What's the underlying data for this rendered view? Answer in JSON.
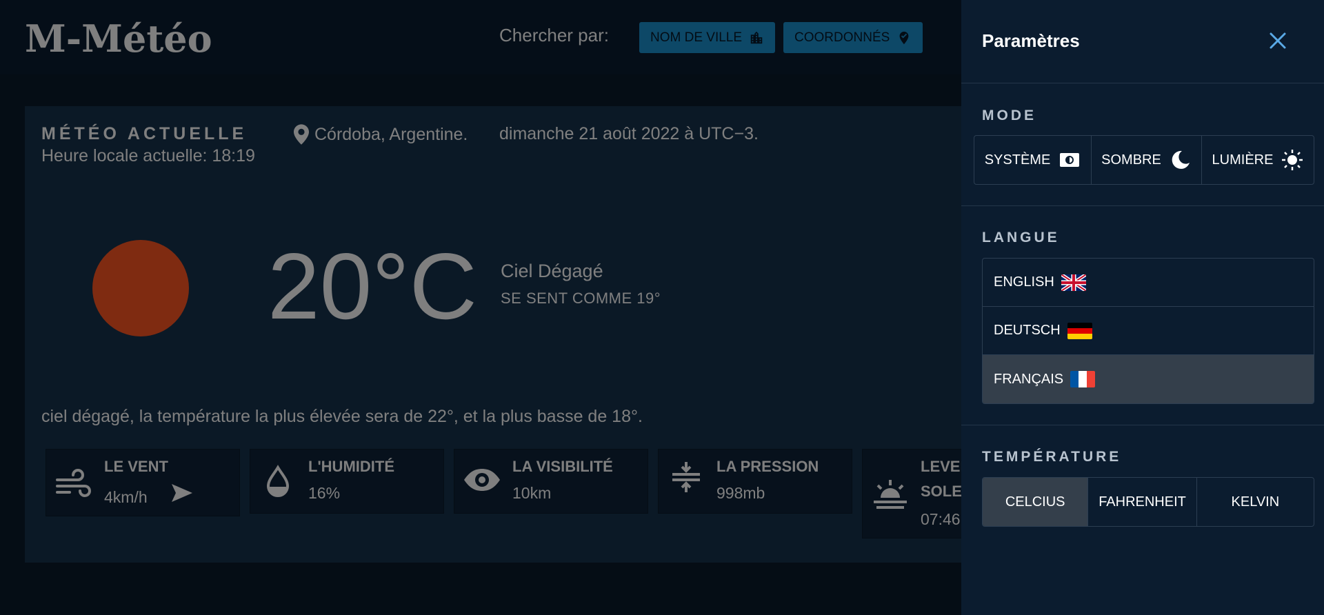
{
  "header": {
    "logo": "M-Météo",
    "search_label": "Chercher par:",
    "city_button": "NOM DE VILLE",
    "coords_button": "COORDONNÉS"
  },
  "current": {
    "title": "MÉTÉO ACTUELLE",
    "local_time": "Heure locale actuelle: 18:19",
    "location": "Córdoba, Argentine.",
    "date": "dimanche 21 août 2022 à UTC−3.",
    "temperature": "20°C",
    "condition": "Ciel Dégagé",
    "feels_like": "SE SENT COMME 19°",
    "summary": "ciel dégagé, la température la plus élevée sera de 22°, et la plus basse de 18°."
  },
  "tiles": [
    {
      "label": "LE VENT",
      "value": "4km/h",
      "icon": "wind-icon"
    },
    {
      "label": "L'HUMIDITÉ",
      "value": "16%",
      "icon": "water-drop-icon"
    },
    {
      "label": "LA VISIBILITÉ",
      "value": "10km",
      "icon": "eye-icon"
    },
    {
      "label": "LA PRESSION",
      "value": "998mb",
      "icon": "compress-icon"
    },
    {
      "label": "LEVER DU SOLEIL",
      "label_line1": "LEVER",
      "label_line2": "SOLEIL",
      "value": "07:46",
      "icon": "sunrise-icon"
    }
  ],
  "settings": {
    "title": "Paramètres",
    "mode_label": "MODE",
    "modes": [
      "SYSTÈME",
      "SOMBRE",
      "LUMIÈRE"
    ],
    "language_label": "LANGUE",
    "languages": [
      "ENGLISH",
      "DEUTSCH",
      "FRANÇAIS"
    ],
    "selected_language": "FRANÇAIS",
    "temperature_label": "TEMPÉRATURE",
    "units": [
      "CELCIUS",
      "FAHRENHEIT",
      "KELVIN"
    ],
    "selected_unit": "CELCIUS"
  },
  "colors": {
    "accent": "#1b90ce",
    "sun": "#ff5722",
    "panel": "#0b1c2f",
    "card": "#17324d",
    "selected": "#343f4b"
  }
}
